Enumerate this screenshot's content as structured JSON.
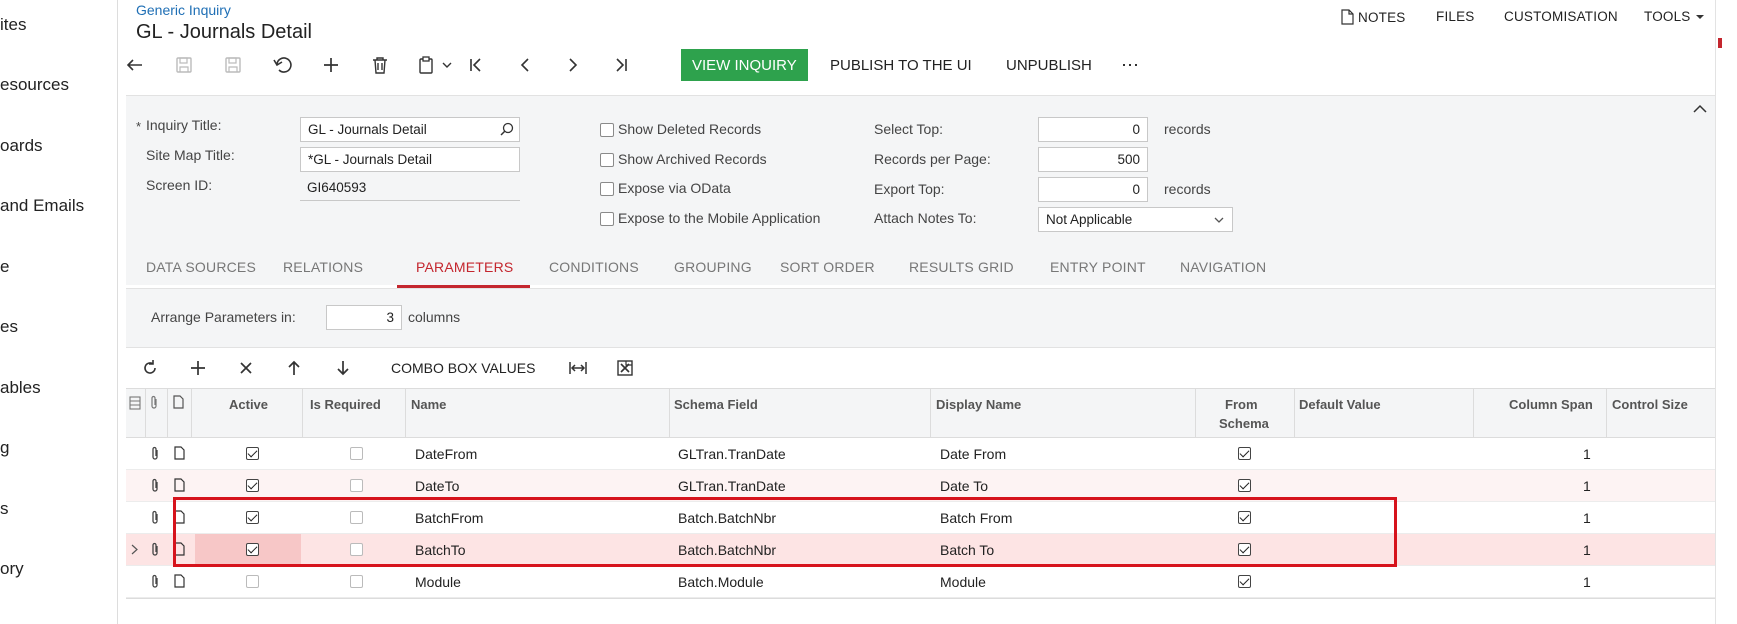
{
  "sidebar": {
    "items": [
      {
        "label": "ites"
      },
      {
        "label": "esources"
      },
      {
        "label": "oards"
      },
      {
        "label": "and Emails"
      },
      {
        "label": "e"
      },
      {
        "label": "es"
      },
      {
        "label": "ables"
      },
      {
        "label": "g"
      },
      {
        "label": "s"
      },
      {
        "label": "ory"
      }
    ]
  },
  "header": {
    "breadcrumb": "Generic Inquiry",
    "title": "GL - Journals Detail",
    "nav": {
      "notes": "NOTES",
      "files": "FILES",
      "customisation": "CUSTOMISATION",
      "tools": "TOOLS"
    }
  },
  "toolbar": {
    "view_inquiry": "VIEW INQUIRY",
    "publish": "PUBLISH TO THE UI",
    "unpublish": "UNPUBLISH",
    "more": "⋯"
  },
  "form": {
    "inquiry_title_label": "Inquiry Title:",
    "inquiry_title_required": "*",
    "inquiry_title_value": "GL - Journals Detail",
    "site_map_title_label": "Site Map Title:",
    "site_map_title_value": "*GL - Journals Detail",
    "screen_id_label": "Screen ID:",
    "screen_id_value": "GI640593",
    "show_deleted": "Show Deleted Records",
    "show_archived": "Show Archived Records",
    "expose_odata": "Expose via OData",
    "expose_mobile": "Expose to the Mobile Application",
    "select_top_label": "Select Top:",
    "select_top_value": "0",
    "select_top_unit": "records",
    "records_per_page_label": "Records per Page:",
    "records_per_page_value": "500",
    "export_top_label": "Export Top:",
    "export_top_value": "0",
    "export_top_unit": "records",
    "attach_notes_label": "Attach Notes To:",
    "attach_notes_value": "Not Applicable"
  },
  "tabs": [
    {
      "label": "DATA SOURCES"
    },
    {
      "label": "RELATIONS"
    },
    {
      "label": "PARAMETERS"
    },
    {
      "label": "CONDITIONS"
    },
    {
      "label": "GROUPING"
    },
    {
      "label": "SORT ORDER"
    },
    {
      "label": "RESULTS GRID"
    },
    {
      "label": "ENTRY POINT"
    },
    {
      "label": "NAVIGATION"
    }
  ],
  "active_tab": "PARAMETERS",
  "params": {
    "arrange_label": "Arrange Parameters in:",
    "arrange_value": "3",
    "arrange_unit": "columns"
  },
  "grid_toolbar": {
    "combo_box_values": "COMBO BOX VALUES"
  },
  "grid": {
    "columns": {
      "active": "Active",
      "is_required": "Is Required",
      "name": "Name",
      "schema_field": "Schema Field",
      "display_name": "Display Name",
      "from_schema_1": "From",
      "from_schema_2": "Schema",
      "default_value": "Default Value",
      "column_span": "Column Span",
      "control_size": "Control Size"
    },
    "rows": [
      {
        "name": "DateFrom",
        "schema_field": "GLTran.TranDate",
        "display_name": "Date From",
        "active": true,
        "required": false,
        "from_schema": true,
        "column_span": "1"
      },
      {
        "name": "DateTo",
        "schema_field": "GLTran.TranDate",
        "display_name": "Date To",
        "active": true,
        "required": false,
        "from_schema": true,
        "column_span": "1"
      },
      {
        "name": "BatchFrom",
        "schema_field": "Batch.BatchNbr",
        "display_name": "Batch From",
        "active": true,
        "required": false,
        "from_schema": true,
        "column_span": "1"
      },
      {
        "name": "BatchTo",
        "schema_field": "Batch.BatchNbr",
        "display_name": "Batch To",
        "active": true,
        "required": false,
        "from_schema": true,
        "column_span": "1"
      },
      {
        "name": "Module",
        "schema_field": "Batch.Module",
        "display_name": "Module",
        "active": false,
        "required": false,
        "from_schema": true,
        "column_span": "1"
      }
    ]
  },
  "colors": {
    "accent": "#c4262e",
    "primary_button": "#2ea24d",
    "link": "#1f6fb5",
    "selected_row": "#fde4e4",
    "alt_row": "#fdf3f3",
    "highlight_frame": "#d6131c"
  }
}
